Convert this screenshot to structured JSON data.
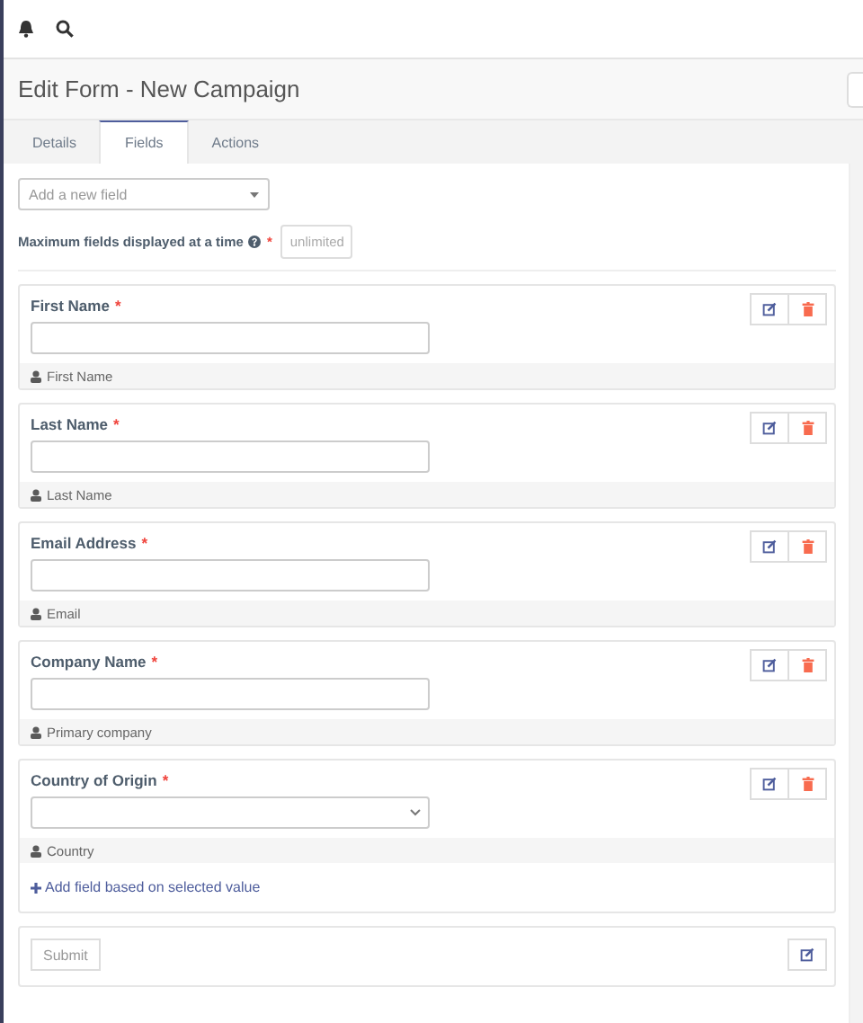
{
  "header": {
    "title": "Edit Form - New Campaign"
  },
  "tabs": [
    {
      "label": "Details",
      "selected": false
    },
    {
      "label": "Fields",
      "selected": true
    },
    {
      "label": "Actions",
      "selected": false
    }
  ],
  "add_field": {
    "placeholder": "Add a new field"
  },
  "max_fields": {
    "label": "Maximum fields displayed at a time",
    "required_mark": "*",
    "placeholder": "unlimited"
  },
  "fields": [
    {
      "kind": "text",
      "label": "First Name",
      "required_mark": "*",
      "footer": "First Name"
    },
    {
      "kind": "text",
      "label": "Last Name",
      "required_mark": "*",
      "footer": "Last Name"
    },
    {
      "kind": "text",
      "label": "Email Address",
      "required_mark": "*",
      "footer": "Email"
    },
    {
      "kind": "text",
      "label": "Company Name",
      "required_mark": "*",
      "footer": "Primary company"
    },
    {
      "kind": "select",
      "label": "Country of Origin",
      "required_mark": "*",
      "footer": "Country",
      "add_link": "Add field based on selected value"
    }
  ],
  "submit": {
    "label": "Submit"
  }
}
